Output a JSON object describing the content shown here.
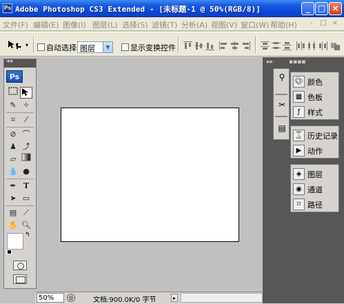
{
  "window": {
    "title": "Adobe Photoshop CS3 Extended - [未标题-1 @ 50%(RGB/8)]",
    "app_icon_text": "Ps",
    "minimize": "_",
    "maximize": "□",
    "close": "×"
  },
  "menu": {
    "items": [
      "文件(F)",
      "编辑(E)",
      "图像(I)",
      "图层(L)",
      "选择(S)",
      "滤镜(T)",
      "分析(A)",
      "视图(V)",
      "窗口(W)",
      "帮助(H)"
    ],
    "doc_controls": [
      "-",
      "□",
      "×"
    ]
  },
  "options": {
    "auto_select_label": "自动选择:",
    "auto_select_checked": false,
    "auto_select_target": "图层",
    "show_transform_label": "显示变换控件",
    "show_transform_checked": false
  },
  "toolbox": {
    "logo": "Ps",
    "collapse_glyph": "◂◂"
  },
  "palettes": {
    "collapse_glyph": "▸▸",
    "groups": [
      {
        "items": [
          {
            "icon": "navigator-icon",
            "label": "颜色"
          },
          {
            "icon": "swatches-icon",
            "label": "色板"
          },
          {
            "icon": "styles-icon",
            "label": "样式"
          }
        ]
      },
      {
        "items": [
          {
            "icon": "history-icon",
            "label": "历史记录"
          },
          {
            "icon": "actions-icon",
            "label": "动作"
          }
        ]
      },
      {
        "items": [
          {
            "icon": "layers-icon",
            "label": "图层"
          },
          {
            "icon": "channels-icon",
            "label": "通道"
          },
          {
            "icon": "paths-icon",
            "label": "路径"
          }
        ]
      }
    ]
  },
  "status": {
    "zoom": "50%",
    "doc_info": "文档:900.0K/0 字节",
    "arrow": "▸"
  }
}
